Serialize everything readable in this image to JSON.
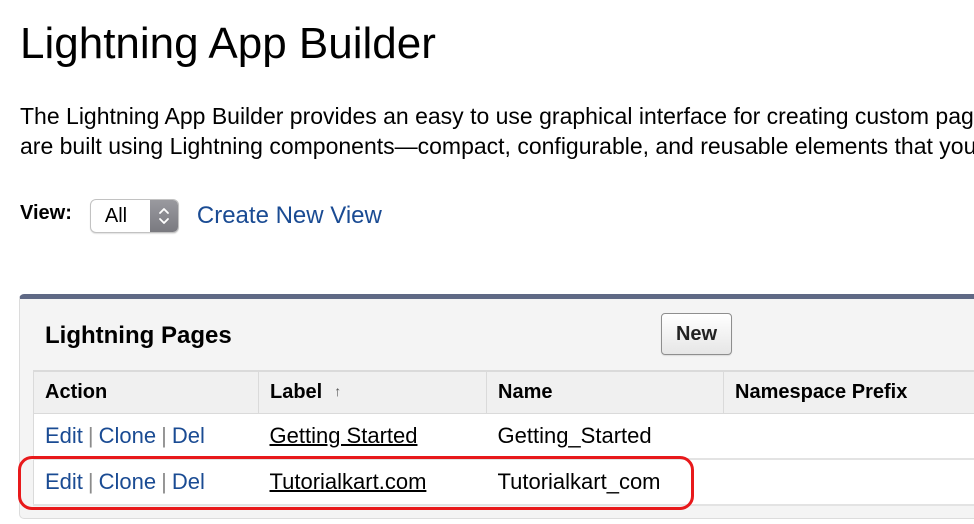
{
  "header": {
    "title": "Lightning App Builder",
    "description_line1": "The Lightning App Builder provides an easy to use graphical interface for creating custom pages. These pages",
    "description_line2": "are built using Lightning components—compact, configurable, and reusable elements that you can drag and drop."
  },
  "view_filter": {
    "label": "View:",
    "selected": "All",
    "select_icon": "updown-chevron-icon",
    "create_link": "Create New View"
  },
  "panel": {
    "title": "Lightning Pages",
    "new_button": "New",
    "columns": [
      {
        "label": "Action"
      },
      {
        "label": "Label",
        "sort_icon": "sort-ascending-arrow-icon",
        "sort_glyph": "↑"
      },
      {
        "label": "Name"
      },
      {
        "label": "Namespace Prefix"
      }
    ],
    "rows": [
      {
        "actions": [
          "Edit",
          "Clone",
          "Del"
        ],
        "label": "Getting Started",
        "name": "Getting_Started",
        "namespace_prefix": ""
      },
      {
        "actions": [
          "Edit",
          "Clone",
          "Del"
        ],
        "label": "Tutorialkart.com",
        "name": "Tutorialkart_com",
        "namespace_prefix": "",
        "highlighted": true
      }
    ],
    "action_separator": "|"
  },
  "colors": {
    "link_blue": "#1a4b93",
    "panel_top_border": "#5f6985",
    "highlight_red": "#e8191b"
  }
}
